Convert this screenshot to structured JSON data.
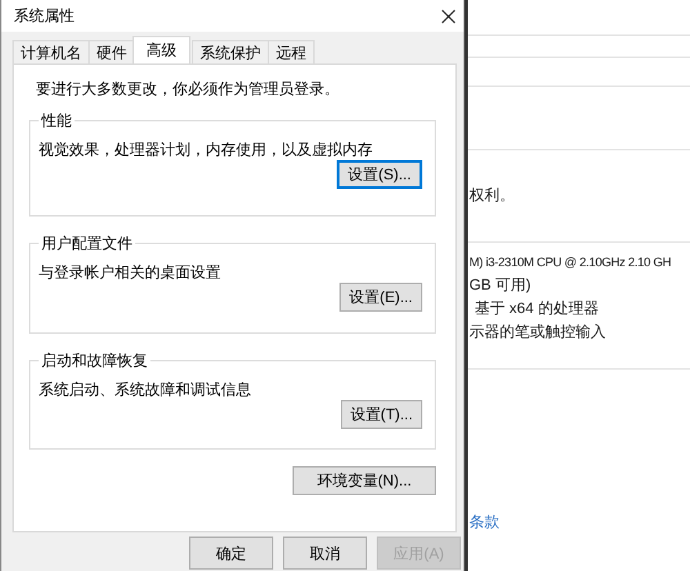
{
  "dialog": {
    "title": "系统属性",
    "tabs": [
      {
        "label": "计算机名",
        "selected": false
      },
      {
        "label": "硬件",
        "selected": false
      },
      {
        "label": "高级",
        "selected": true
      },
      {
        "label": "系统保护",
        "selected": false
      },
      {
        "label": "远程",
        "selected": false
      }
    ],
    "notice": "要进行大多数更改，你必须作为管理员登录。",
    "groups": [
      {
        "title": "性能",
        "description": "视觉效果，处理器计划，内存使用，以及虚拟内存",
        "button": {
          "label": "设置(S)...",
          "default": true
        }
      },
      {
        "title": "用户配置文件",
        "description": "与登录帐户相关的桌面设置",
        "button": {
          "label": "设置(E)...",
          "default": false
        }
      },
      {
        "title": "启动和故障恢复",
        "description": "系统启动、系统故障和调试信息",
        "button": {
          "label": "设置(T)...",
          "default": false
        }
      }
    ],
    "env_button": "环境变量(N)...",
    "footer_buttons": [
      {
        "label": "确定",
        "disabled": false
      },
      {
        "label": "取消",
        "disabled": false
      },
      {
        "label": "应用(A)",
        "disabled": true
      }
    ]
  },
  "background_window": {
    "notice_tail": "权利。",
    "specs": [
      "M) i3-2310M CPU @ 2.10GHz   2.10 GH",
      "GB 可用)",
      "基于 x64 的处理器",
      "示器的笔或触控输入"
    ],
    "link": "条款"
  }
}
